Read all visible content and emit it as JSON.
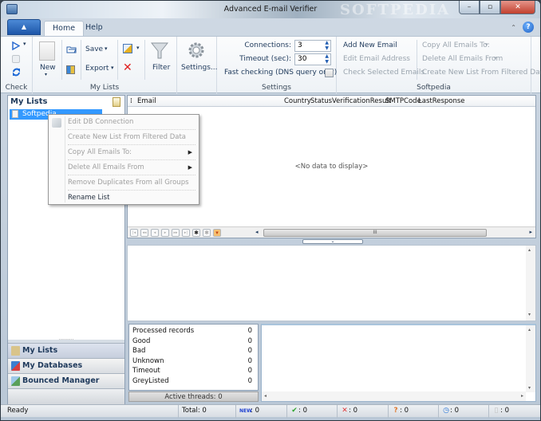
{
  "window": {
    "title": "Advanced E-mail Verifier",
    "watermark": "SOFTPEDIA",
    "controls": {
      "minimize": "–",
      "maximize": "▫",
      "close": "✕"
    }
  },
  "ribbon_tabs": {
    "app_button": "▲",
    "tabs": [
      {
        "label": "Home",
        "active": true
      },
      {
        "label": "Help",
        "active": false
      }
    ],
    "collapse_icon": "⌃",
    "help_icon": "?"
  },
  "ribbon": {
    "check_group": {
      "label": "Check",
      "icons": [
        "play-icon",
        "stop-icon",
        "refresh-icon"
      ],
      "dropdown": "▾"
    },
    "my_lists_group": {
      "label": "My Lists",
      "new_label": "New",
      "save_label": "Save",
      "export_label": "Export",
      "filter_label": "Filter",
      "dropdown": "▾"
    },
    "settings_button": "Settings...",
    "settings_group": {
      "label": "Settings",
      "connections_label": "Connections:",
      "connections_value": "3",
      "timeout_label": "Timeout (sec):",
      "timeout_value": "30",
      "fast_checking_label": "Fast checking (DNS query only)",
      "fast_checking_checked": false
    },
    "softpedia_group": {
      "label": "Softpedia",
      "add_new_email": "Add New Email",
      "edit_email_address": "Edit Email Address",
      "check_selected_emails": "Check Selected Emails",
      "copy_all_emails_to": "Copy All Emails To:",
      "delete_all_emails_from": "Delete All Emails From",
      "create_new_list": "Create New List From Filtered Data",
      "dropdown": "▾"
    }
  },
  "left_pane": {
    "title": "My Lists",
    "items": [
      {
        "label": "Softpedia",
        "selected": true
      }
    ],
    "splitter": "··········",
    "nav": [
      {
        "label": "My Lists",
        "selected": true,
        "color": "#d9c48a"
      },
      {
        "label": "My Databases",
        "selected": false,
        "color": "#3d7fd0"
      },
      {
        "label": "Bounced Manager",
        "selected": false,
        "color": "#5aa05a"
      }
    ]
  },
  "context_menu": {
    "items": [
      {
        "label": "Edit DB Connection",
        "enabled": false,
        "submenu": false
      },
      {
        "label": "Create New List From Filtered Data",
        "enabled": false,
        "submenu": false
      },
      {
        "label": "Copy All Emails To:",
        "enabled": false,
        "submenu": true
      },
      {
        "label": "Delete All Emails From",
        "enabled": false,
        "submenu": true
      },
      {
        "label": "Remove Duplicates From all Groups",
        "enabled": false,
        "submenu": false
      },
      {
        "label": "Rename List",
        "enabled": true,
        "submenu": false
      }
    ],
    "submenu_arrow": "▶"
  },
  "grid": {
    "columns": [
      "Email",
      "Country",
      "Status",
      "VerificationResult",
      "SMTPCode",
      "LastResponse"
    ],
    "column_chooser_icon": "⁞",
    "empty_text": "<No data to display>",
    "navigator": {
      "buttons": [
        "first",
        "prev-page",
        "prev",
        "next",
        "next-page",
        "last",
        "append",
        "edit",
        "filter"
      ],
      "scroll_left": "◂",
      "scroll_right": "▸",
      "thumb_grip": "III"
    },
    "splitter_toggle": "⌄"
  },
  "log_pane": {
    "scroll_up": "▴",
    "scroll_down": "▾"
  },
  "stats": {
    "rows": [
      {
        "label": "Processed records",
        "value": "0"
      },
      {
        "label": "Good",
        "value": "0"
      },
      {
        "label": "Bad",
        "value": "0"
      },
      {
        "label": "Unknown",
        "value": "0"
      },
      {
        "label": "Timeout",
        "value": "0"
      },
      {
        "label": "GreyListed",
        "value": "0"
      }
    ],
    "active_threads": "Active threads: 0"
  },
  "response_pane": {
    "scroll_left": "◂",
    "scroll_right": "▸",
    "scroll_up": "▴",
    "scroll_down": "▾"
  },
  "statusbar": {
    "status": "Ready",
    "total": "Total: 0",
    "new": {
      "icon": "NEW",
      "value": ": 0",
      "color": "#1d3fd0"
    },
    "good": {
      "icon": "✔",
      "value": ": 0",
      "color": "#2fa52f"
    },
    "bad": {
      "icon": "✕",
      "value": ": 0",
      "color": "#e23a3a"
    },
    "unknown": {
      "icon": "?",
      "value": ": 0",
      "color": "#e07a30"
    },
    "timeout": {
      "icon": "◷",
      "value": ": 0",
      "color": "#2f7ad8"
    },
    "greylisted": {
      "icon": "▯",
      "value": ": 0",
      "color": "#c0c0c0"
    }
  }
}
